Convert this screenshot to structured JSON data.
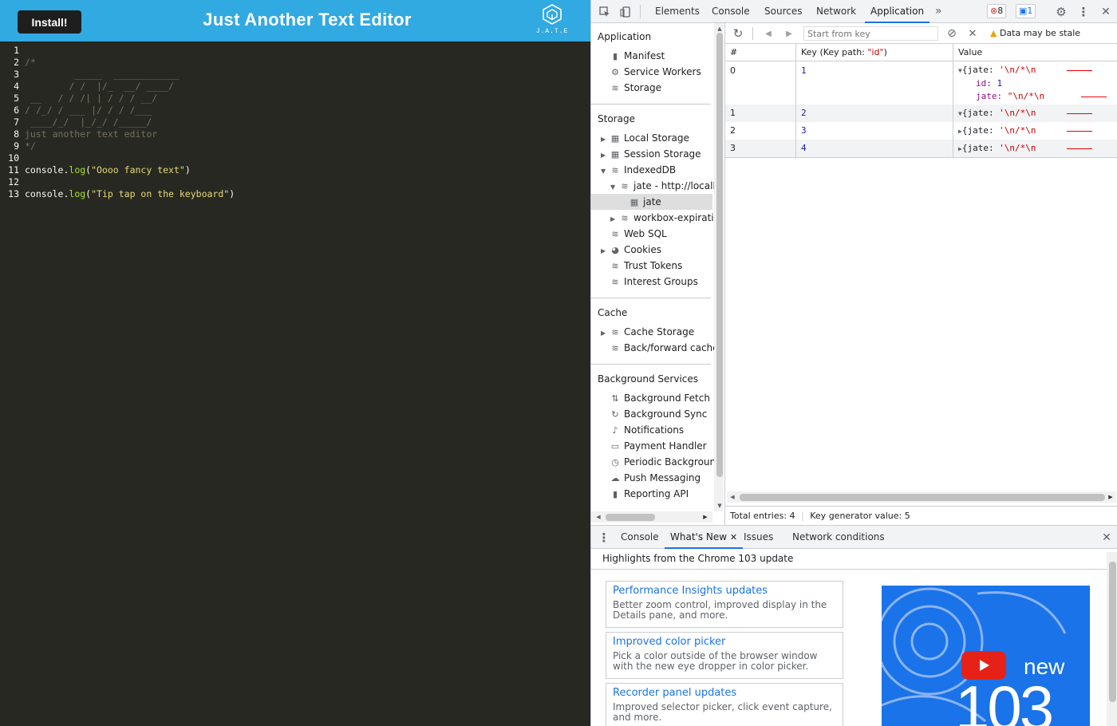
{
  "app": {
    "install_label": "Install!",
    "title": "Just Another Text Editor",
    "logo_text": "J.A.T.E",
    "editor_lines": [
      {
        "n": "1",
        "parts": []
      },
      {
        "n": "2",
        "parts": [
          {
            "c": "cmt",
            "t": "/*"
          }
        ]
      },
      {
        "n": "3",
        "parts": [
          {
            "c": "cmt",
            "t": "         _____  ____________"
          }
        ]
      },
      {
        "n": "4",
        "parts": [
          {
            "c": "cmt",
            "t": "        / /  |/_  __/ ____/"
          }
        ]
      },
      {
        "n": "5",
        "parts": [
          {
            "c": "cmt",
            "t": " __   / / /| | / / / __/"
          }
        ]
      },
      {
        "n": "6",
        "parts": [
          {
            "c": "cmt",
            "t": "/ /_/ / ___ |/ / / /___"
          }
        ]
      },
      {
        "n": "7",
        "parts": [
          {
            "c": "cmt",
            "t": " ____/_/  |_/_/ /_____/"
          }
        ]
      },
      {
        "n": "8",
        "parts": [
          {
            "c": "cmt",
            "t": "just another text editor"
          }
        ]
      },
      {
        "n": "9",
        "parts": [
          {
            "c": "cmt",
            "t": "*/"
          }
        ]
      },
      {
        "n": "10",
        "parts": []
      },
      {
        "n": "11",
        "parts": [
          {
            "c": "id",
            "t": "console."
          },
          {
            "c": "fn",
            "t": "log"
          },
          {
            "c": "id",
            "t": "("
          },
          {
            "c": "str",
            "t": "\"Oooo fancy text\""
          },
          {
            "c": "id",
            "t": ")"
          }
        ]
      },
      {
        "n": "12",
        "parts": []
      },
      {
        "n": "13",
        "parts": [
          {
            "c": "id",
            "t": "console."
          },
          {
            "c": "fn",
            "t": "log"
          },
          {
            "c": "id",
            "t": "("
          },
          {
            "c": "str",
            "t": "\"Tip tap on the keyboard\""
          },
          {
            "c": "id",
            "t": ")"
          }
        ]
      }
    ]
  },
  "devtools": {
    "tabs": {
      "elements": "Elements",
      "console": "Console",
      "sources": "Sources",
      "network": "Network",
      "application": "Application",
      "more": "»",
      "errors": "8",
      "messages": "1"
    },
    "sidebar": {
      "sections": {
        "application": "Application",
        "storage": "Storage",
        "cache": "Cache",
        "background_services": "Background Services"
      },
      "items": {
        "manifest": "Manifest",
        "service_workers": "Service Workers",
        "storage": "Storage",
        "local_storage": "Local Storage",
        "session_storage": "Session Storage",
        "indexeddb": "IndexedDB",
        "jate_db": "jate - http://localh",
        "jate_store": "jate",
        "workbox": "workbox-expiratio",
        "websql": "Web SQL",
        "cookies": "Cookies",
        "trust_tokens": "Trust Tokens",
        "interest_groups": "Interest Groups",
        "cache_storage": "Cache Storage",
        "bfcache": "Back/forward cache",
        "bg_fetch": "Background Fetch",
        "bg_sync": "Background Sync",
        "notifications": "Notifications",
        "payment_handler": "Payment Handler",
        "periodic_bg": "Periodic Background",
        "push_messaging": "Push Messaging",
        "reporting_api": "Reporting API"
      }
    },
    "toolbar": {
      "start_from_key_placeholder": "Start from key",
      "stale_warning": "Data may be stale"
    },
    "grid": {
      "columns": [
        "#",
        "Key (Key path: ",
        "\"id\"",
        ")",
        "Value"
      ],
      "rows": [
        {
          "index": "0",
          "key": "1",
          "value_open": "{jate: ",
          "value_str": "'\\n/*\\n",
          "id_label": "id: ",
          "id_val": "1",
          "jate_label": "jate: ",
          "jate_val": "\"\\n/*\\n"
        },
        {
          "index": "1",
          "key": "2",
          "value_open": "{jate: ",
          "value_str": "'\\n/*\\n"
        },
        {
          "index": "2",
          "key": "3",
          "value_open": "{jate: ",
          "value_str": "'\\n/*\\n"
        },
        {
          "index": "3",
          "key": "4",
          "value_open": "{jate: ",
          "value_str": "'\\n/*\\n"
        }
      ]
    },
    "status": {
      "total_entries": "Total entries: 4",
      "key_generator": "Key generator value: 5"
    },
    "drawer": {
      "tabs": {
        "console": "Console",
        "whats_new": "What's New",
        "issues": "Issues",
        "network_conditions": "Network conditions"
      },
      "highlights": "Highlights from the Chrome 103 update",
      "cards": [
        {
          "title": "Performance Insights updates",
          "desc": "Better zoom control, improved display in the Details pane, and more."
        },
        {
          "title": "Improved color picker",
          "desc": "Pick a color outside of the browser window with the new eye dropper in color picker."
        },
        {
          "title": "Recorder panel updates",
          "desc": "Improved selector picker, click event capture, and more."
        }
      ],
      "promo_new": "new",
      "promo_version": "103"
    }
  },
  "colors": {
    "header": "#31a9e1",
    "editor_bg": "#272822",
    "devtools_accent": "#1a73e8",
    "promo": "#1a73e8"
  }
}
